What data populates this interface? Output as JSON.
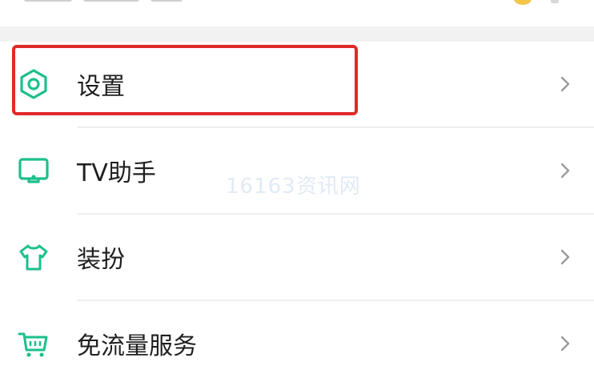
{
  "menu": {
    "items": [
      {
        "label": "设置",
        "icon": "gear-hexagon-icon"
      },
      {
        "label": "TV助手",
        "icon": "tv-icon"
      },
      {
        "label": "装扮",
        "icon": "tshirt-icon"
      },
      {
        "label": "免流量服务",
        "icon": "cart-icon"
      }
    ]
  },
  "watermark": "16163资讯网",
  "colors": {
    "accent": "#1dbf8c",
    "highlight": "#e02a2a",
    "chevron": "#9a9a9a"
  }
}
